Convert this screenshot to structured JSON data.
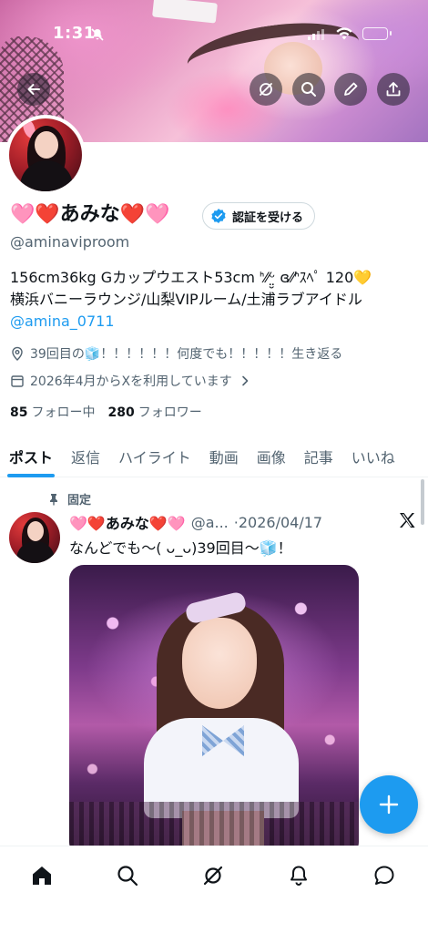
{
  "status_bar": {
    "time": "1:31"
  },
  "profile": {
    "display_name": "🩷❤️あみな❤️🩷",
    "verify_label": "認証を受ける",
    "handle": "@aminaviproom",
    "bio_line1": "156cm36kg Gカップウエスト53cm ᑋ⁄⁄ᵕ̤̮ ɞ⁄⁄ᑋｽﾍﾟ 120💛",
    "bio_line2": "横浜バニーラウンジ/山梨VIPルーム/土浦ラブアイドル",
    "bio_link": "@amina_0711",
    "location": "39回目の🧊！！！！！！何度でも！！！！！生き返る",
    "joined": "2026年4月からXを利用しています",
    "following_count": "85",
    "following_label": "フォロー中",
    "followers_count": "280",
    "followers_label": "フォロワー"
  },
  "tabs": [
    {
      "label": "ポスト",
      "active": true
    },
    {
      "label": "返信",
      "active": false
    },
    {
      "label": "ハイライト",
      "active": false
    },
    {
      "label": "動画",
      "active": false
    },
    {
      "label": "画像",
      "active": false
    },
    {
      "label": "記事",
      "active": false
    },
    {
      "label": "いいね",
      "active": false
    }
  ],
  "pinned_post": {
    "pinned_label": "固定",
    "name": "🩷❤️あみな❤️🩷",
    "handle": "@a...",
    "date": "·2026/04/17",
    "text": "なんどでも〜( ᴗ_ᴗ)39回目〜🧊！"
  },
  "icons": {
    "back": "back-arrow-icon",
    "grok": "grok-icon",
    "search": "search-icon",
    "edit": "edit-pencil-icon",
    "share": "share-icon",
    "fab": "plus-icon",
    "nav": [
      "home-icon",
      "search-icon",
      "grok-icon",
      "bell-icon",
      "messages-icon"
    ]
  },
  "colors": {
    "accent": "#1d9bf0",
    "text": "#0f1419",
    "secondary": "#536471"
  }
}
